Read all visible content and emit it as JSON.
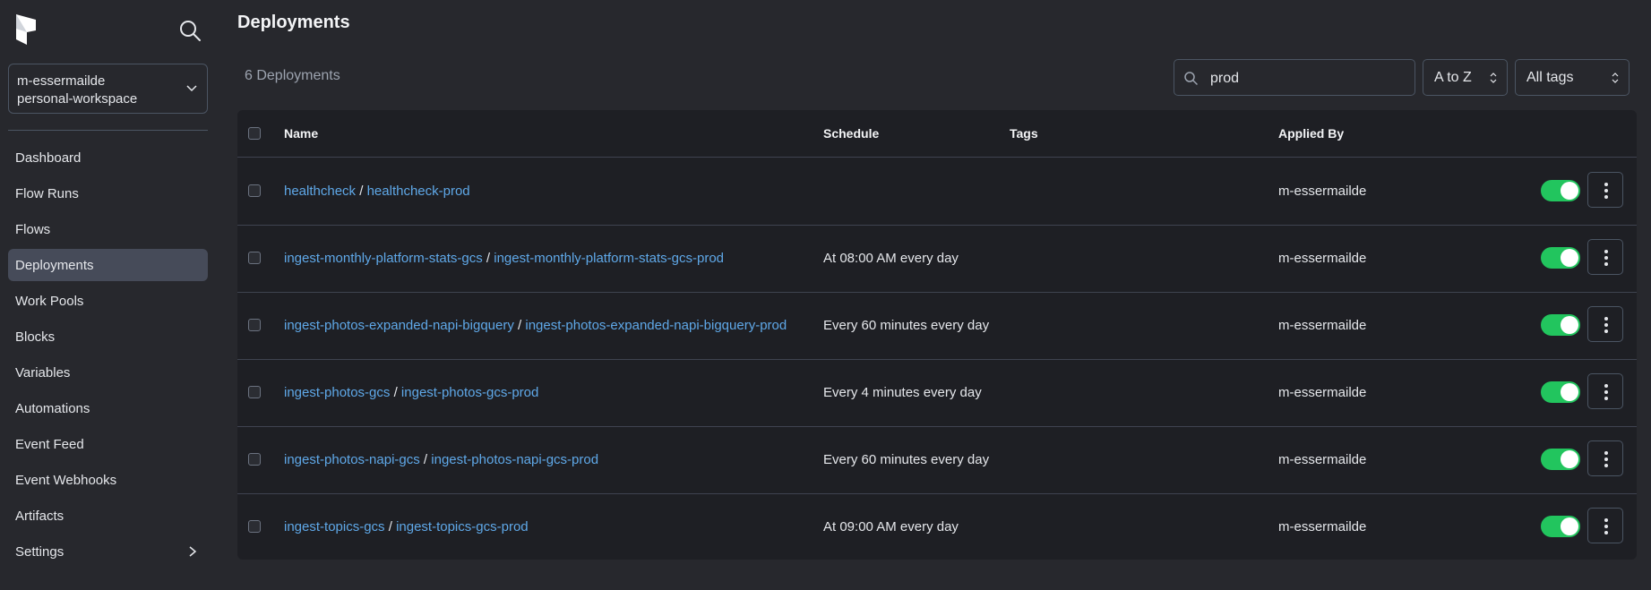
{
  "sidebar": {
    "workspace": {
      "account": "m-essermailde",
      "name": "personal-workspace"
    },
    "items": [
      {
        "label": "Dashboard"
      },
      {
        "label": "Flow Runs"
      },
      {
        "label": "Flows"
      },
      {
        "label": "Deployments",
        "active": true
      },
      {
        "label": "Work Pools"
      },
      {
        "label": "Blocks"
      },
      {
        "label": "Variables"
      },
      {
        "label": "Automations"
      },
      {
        "label": "Event Feed"
      },
      {
        "label": "Event Webhooks"
      },
      {
        "label": "Artifacts"
      },
      {
        "label": "Settings"
      }
    ]
  },
  "header": {
    "title": "Deployments"
  },
  "toolbar": {
    "count": "6 Deployments",
    "search_value": "prod",
    "sort_value": "A to Z",
    "tags_value": "All tags"
  },
  "table": {
    "columns": {
      "name": "Name",
      "schedule": "Schedule",
      "tags": "Tags",
      "applied_by": "Applied By"
    },
    "rows": [
      {
        "flow": "healthcheck",
        "deployment": "healthcheck-prod",
        "schedule": "",
        "applied_by": "m-essermailde",
        "active": true
      },
      {
        "flow": "ingest-monthly-platform-stats-gcs",
        "deployment": "ingest-monthly-platform-stats-gcs-prod",
        "schedule": "At 08:00 AM every day",
        "applied_by": "m-essermailde",
        "active": true
      },
      {
        "flow": "ingest-photos-expanded-napi-bigquery",
        "deployment": "ingest-photos-expanded-napi-bigquery-prod",
        "schedule": "Every 60 minutes every day",
        "applied_by": "m-essermailde",
        "active": true
      },
      {
        "flow": "ingest-photos-gcs",
        "deployment": "ingest-photos-gcs-prod",
        "schedule": "Every 4 minutes every day",
        "applied_by": "m-essermailde",
        "active": true
      },
      {
        "flow": "ingest-photos-napi-gcs",
        "deployment": "ingest-photos-napi-gcs-prod",
        "schedule": "Every 60 minutes every day",
        "applied_by": "m-essermailde",
        "active": true
      },
      {
        "flow": "ingest-topics-gcs",
        "deployment": "ingest-topics-gcs-prod",
        "schedule": "At 09:00 AM every day",
        "applied_by": "m-essermailde",
        "active": true
      }
    ]
  },
  "colors": {
    "background": "#27282d",
    "table": "#1e1f24",
    "link": "#5fa8e8",
    "toggle_on": "#22c55e",
    "active_nav": "#464b59"
  },
  "icons": {
    "logo": "prefect-logo",
    "search": "search-icon",
    "chevron": "chevron-down-icon",
    "settings_arrow": "chevron-right-icon",
    "menu": "kebab-menu-icon"
  }
}
